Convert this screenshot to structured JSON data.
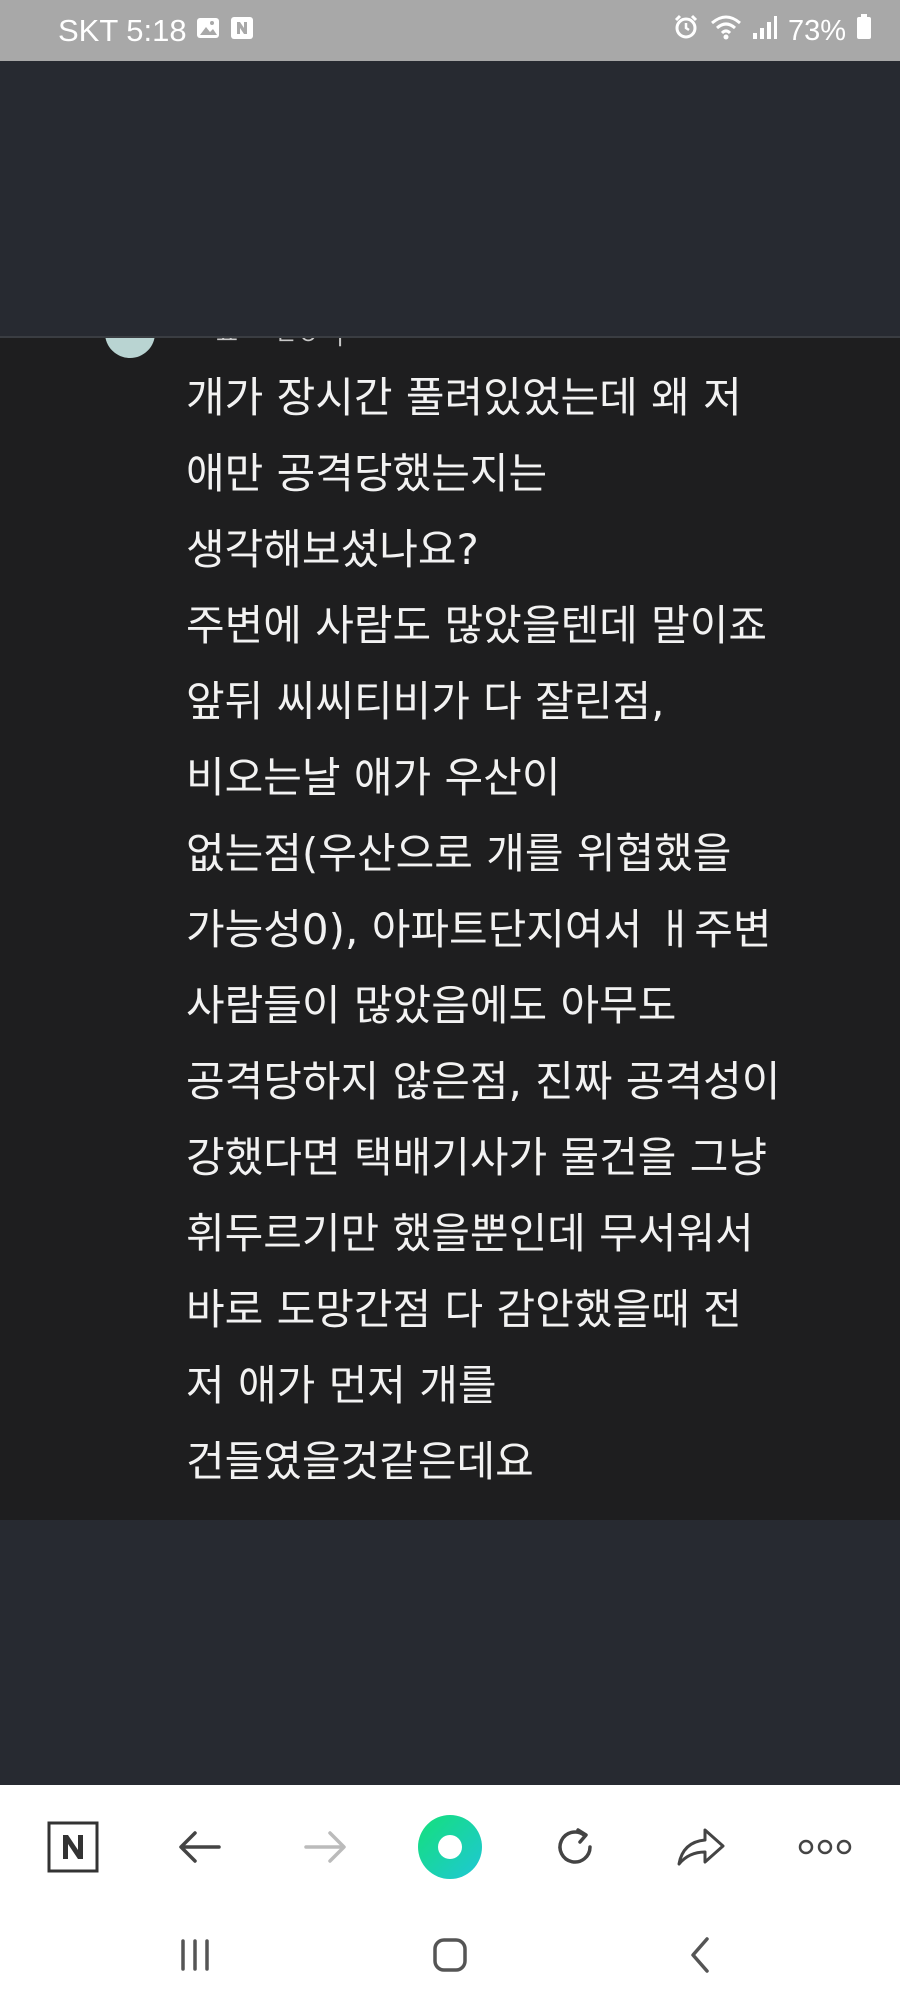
{
  "status_bar": {
    "carrier": "SKT",
    "time": "5:18",
    "battery": "73%",
    "icons": [
      "gallery-icon",
      "naver-app-icon",
      "alarm-icon",
      "wifi-icon",
      "signal-icon",
      "battery-icon"
    ]
  },
  "comment": {
    "meta_fragment": "ㅡ ㅛ ㅡ ㄹㅇ ㅓㅡ ㅡ",
    "lines": [
      "개가 장시간 풀려있었는데 왜 저",
      "애만 공격당했는지는",
      "생각해보셨나요?",
      "주변에 사람도 많았을텐데 말이죠",
      "앞뒤 씨씨티비가 다 잘린점,",
      "비오는날 애가 우산이",
      "없는점(우산으로 개를 위협했을",
      "가능성0), 아파트단지여서 ㅐ주변",
      "사람들이 많았음에도 아무도",
      "공격당하지 않은점, 진짜 공격성이",
      "강했다면 택배기사가 물건을 그냥",
      "휘두르기만 했을뿐인데 무서워서",
      "바로 도망간점 다 감안했을때 전",
      "저 애가 먼저 개를",
      "건들였을것같은데요"
    ]
  },
  "bottom_nav": {
    "buttons": [
      "naver-home-icon",
      "back-arrow-icon",
      "forward-arrow-icon",
      "green-dot-icon",
      "refresh-icon",
      "share-icon",
      "more-icon"
    ]
  },
  "system_nav": {
    "buttons": [
      "recent-apps-icon",
      "home-icon",
      "back-icon"
    ]
  },
  "colors": {
    "status_bar": "#a8a8a8",
    "background": "#272a31",
    "comment_bg": "#1e1e1f",
    "text": "#f2f2f2",
    "green_button": "#1fd6a1"
  }
}
